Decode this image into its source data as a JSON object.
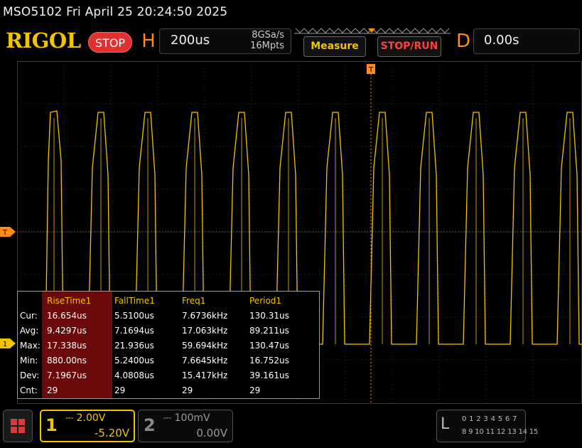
{
  "title_bar": {
    "text": "MSO5102  Fri April 25 20:24:50 2025"
  },
  "header": {
    "logo": "RIGOL",
    "run_state": "STOP",
    "horizontal": {
      "label": "H",
      "timebase": "200us",
      "sample_rate": "8GSa/s",
      "memory_depth": "16Mpts"
    },
    "measure_button": "Measure",
    "stop_run_button": "STOP/RUN",
    "delay": {
      "label": "D",
      "value": "0.00s"
    }
  },
  "markers": {
    "trigger": "T",
    "channel1": "1"
  },
  "measurements": {
    "columns": [
      "RiseTime1",
      "FallTime1",
      "Freq1",
      "Period1"
    ],
    "rows": [
      {
        "label": "Cur:",
        "values": [
          "16.654us",
          "5.5100us",
          "7.6736kHz",
          "130.31us"
        ]
      },
      {
        "label": "Avg:",
        "values": [
          "9.4297us",
          "7.1694us",
          "17.063kHz",
          "89.211us"
        ]
      },
      {
        "label": "Max:",
        "values": [
          "17.338us",
          "21.936us",
          "59.694kHz",
          "130.47us"
        ]
      },
      {
        "label": "Min:",
        "values": [
          "880.00ns",
          "5.2400us",
          "7.6645kHz",
          "16.752us"
        ]
      },
      {
        "label": "Dev:",
        "values": [
          "7.1967us",
          "4.0808us",
          "15.417kHz",
          "39.161us"
        ]
      },
      {
        "label": "Cnt:",
        "values": [
          "29",
          "29",
          "29",
          "29"
        ]
      }
    ]
  },
  "channels": {
    "ch1": {
      "number": "1",
      "scale": "2.00V",
      "offset": "-5.20V",
      "color": "#f2c400"
    },
    "ch2": {
      "number": "2",
      "scale": "100mV",
      "offset": "0.00V"
    }
  },
  "logic_analyzer": {
    "label": "L",
    "row1": "0 1 2 3   4 5 6 7",
    "row2": "8 9 10 11  12 13 14 15"
  },
  "colors": {
    "accent": "#f2c400",
    "stop": "#e03030",
    "orange": "#ff8c1a",
    "highlight": "#6b0a0a"
  },
  "icons": {
    "menu": "menu-grid-icon",
    "trigger_marker": "trigger-position-icon"
  }
}
